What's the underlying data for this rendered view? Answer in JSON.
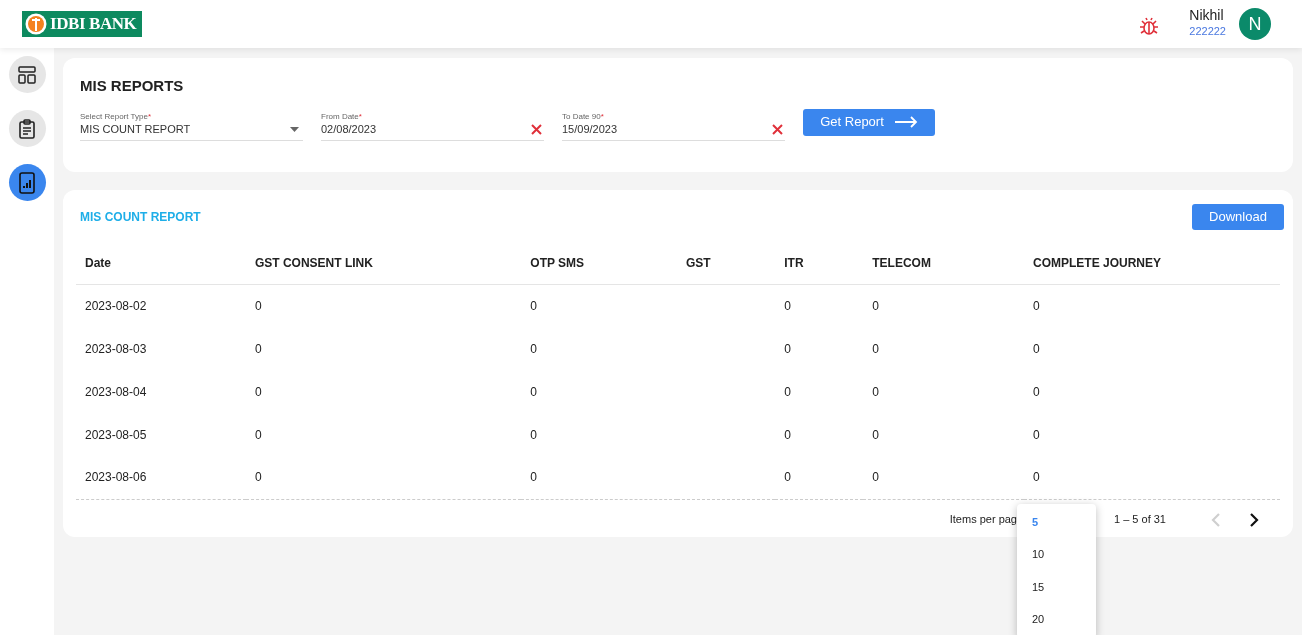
{
  "header": {
    "logo_text": "IDBI BANK",
    "user_name": "Nikhil",
    "user_id": "222222",
    "avatar_letter": "N"
  },
  "sidebar": {
    "items": [
      {
        "selected": false
      },
      {
        "selected": false
      },
      {
        "selected": true
      }
    ]
  },
  "filters": {
    "title": "MIS REPORTS",
    "fields": [
      {
        "kind": "select",
        "label": "Select Report Type",
        "required_mark": "*",
        "value": "MIS COUNT REPORT"
      },
      {
        "kind": "date",
        "label": "From Date",
        "required_mark": "*",
        "value": "02/08/2023"
      },
      {
        "kind": "date",
        "label": "To Date 90",
        "required_mark": "*",
        "value": "15/09/2023"
      }
    ],
    "button": "Get Report"
  },
  "report": {
    "title": "MIS COUNT REPORT",
    "download": "Download",
    "columns": [
      "Date",
      "GST CONSENT LINK",
      "OTP SMS",
      "GST",
      "ITR",
      "TELECOM",
      "COMPLETE JOURNEY"
    ],
    "rows": [
      [
        "2023-08-02",
        "0",
        "0",
        "",
        "0",
        "0",
        "0"
      ],
      [
        "2023-08-03",
        "0",
        "0",
        "",
        "0",
        "0",
        "0"
      ],
      [
        "2023-08-04",
        "0",
        "0",
        "",
        "0",
        "0",
        "0"
      ],
      [
        "2023-08-05",
        "0",
        "0",
        "",
        "0",
        "0",
        "0"
      ],
      [
        "2023-08-06",
        "0",
        "0",
        "",
        "0",
        "0",
        "0"
      ]
    ],
    "paginator": {
      "items_per_page_label": "Items per pag",
      "range": "1 – 5 of 31",
      "prev_disabled": true,
      "next_disabled": false,
      "page_size_options": [
        {
          "label": "5",
          "selected": true
        },
        {
          "label": "10",
          "selected": false
        },
        {
          "label": "15",
          "selected": false
        },
        {
          "label": "20",
          "selected": false
        }
      ]
    }
  }
}
